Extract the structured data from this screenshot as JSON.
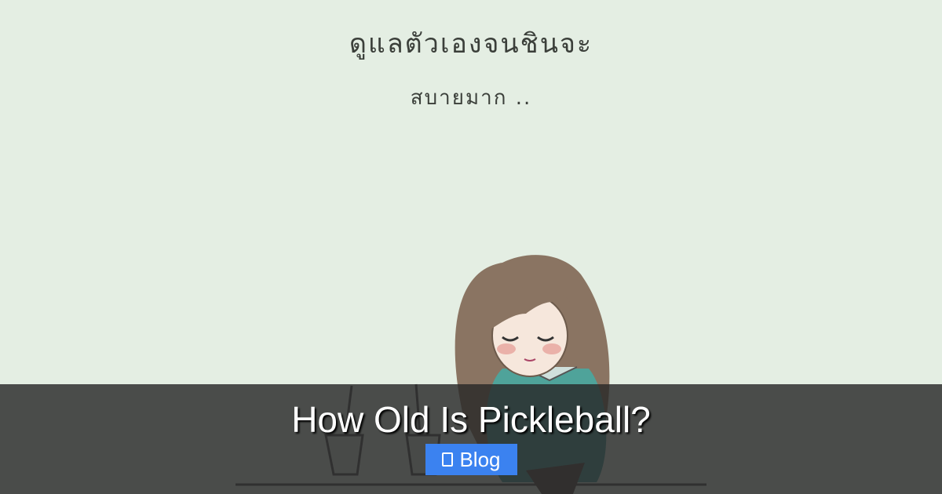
{
  "hero": {
    "background_color": "#e4eee3",
    "illustration": "girl-sitting-illustration",
    "handwritten_lines": [
      "ดูแลตัวเองจนชินจะ",
      "สบายมาก .."
    ]
  },
  "post": {
    "title": "How Old Is Pickleball?",
    "category": "Blog",
    "category_icon": "folder-icon",
    "category_color": "#3b82f0"
  }
}
